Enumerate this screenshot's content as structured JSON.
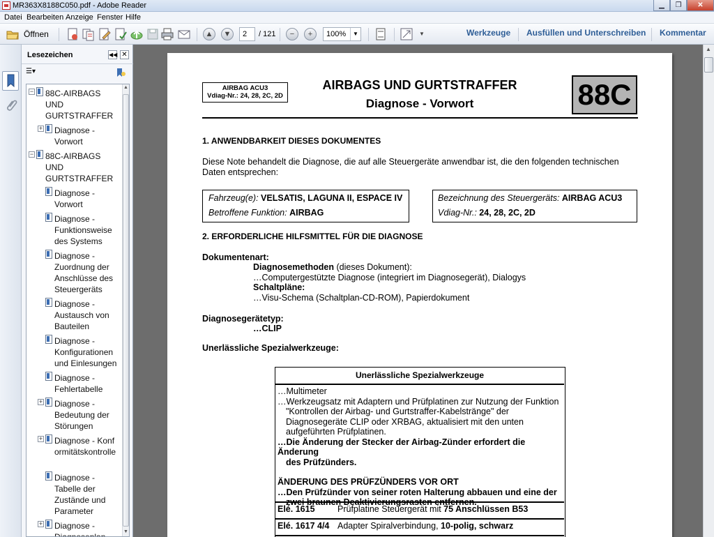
{
  "window": {
    "title": "MR363X8188C050.pdf - Adobe Reader"
  },
  "menu": [
    "Datei",
    "Bearbeiten",
    "Anzeige",
    "Fenster",
    "Hilfe"
  ],
  "toolbar": {
    "open_label": "Öffnen",
    "page_current": "2",
    "page_total": "/ 121",
    "zoom": "100%",
    "tools_label": "Werkzeuge",
    "fill_sign_label": "Ausfüllen und Unterschreiben",
    "comment_label": "Kommentar"
  },
  "bookmarks": {
    "title": "Lesezeichen",
    "items": [
      {
        "label": "88C-AIRBAGS UND GURTSTRAFFER"
      },
      {
        "label": "Diagnose - Vorwort"
      },
      {
        "label": "88C-AIRBAGS UND GURTSTRAFFER"
      },
      {
        "label": "Diagnose - Vorwort"
      },
      {
        "label": "Diagnose - Funktionsweise des Systems"
      },
      {
        "label": "Diagnose - Zuordnung der Anschlüsse des Steuergeräts"
      },
      {
        "label": "Diagnose - Austausch von Bauteilen"
      },
      {
        "label": "Diagnose - Konfigurationen und Einlesungen"
      },
      {
        "label": "Diagnose - Fehlertabelle"
      },
      {
        "label": "Diagnose - Bedeutung der Störungen"
      },
      {
        "label": "Diagnose - Konformitätskontrolle"
      },
      {
        "label": "Diagnose - Tabelle der Zustände und Parameter"
      },
      {
        "label": "Diagnose - Diagnoseplan"
      }
    ]
  },
  "doc": {
    "header_box_line1": "AIRBAG ACU3",
    "header_box_line2": "Vdiag-Nr.: 24, 28, 2C, 2D",
    "title": "AIRBAGS UND GURTSTRAFFER",
    "subtitle": "Diagnose - Vorwort",
    "code": "88C",
    "section1": "1. ANWENDBARKEIT DIESES DOKUMENTES",
    "intro": "Diese Note behandelt die Diagnose, die auf alle Steuergeräte anwendbar ist, die den folgenden technischen Daten entsprechen:",
    "vehicle_label": "Fahrzeug(e):",
    "vehicle_value": "VELSATIS, LAGUNA II, ESPACE IV",
    "function_label": "Betroffene Funktion:",
    "function_value": "AIRBAG",
    "ecu_label": "Bezeichnung des Steuergeräts:",
    "ecu_value": "AIRBAG ACU3",
    "vdiag_label": "Vdiag-Nr.:",
    "vdiag_value": "24, 28, 2C, 2D",
    "section2": "2. ERFORDERLICHE HILFSMITTEL FÜR DIE DIAGNOSE",
    "doc_type": "Dokumentenart:",
    "diag_methods": "Diagnosemethoden",
    "diag_methods_suffix": " (dieses Dokument):",
    "diag_methods_item": "…Computergestützte Diagnose (integriert im Diagnosegerät), Dialogys",
    "wiring": "Schaltpläne:",
    "wiring_item": "…Visu-Schema (Schaltplan-CD-ROM), Papierdokument",
    "diag_tool_type": "Diagnosegerätetyp:",
    "diag_tool_item": "…CLIP",
    "special_tools": "Unerlässliche Spezialwerkzeuge:",
    "table_header": "Unerlässliche Spezialwerkzeuge",
    "t_line1": "…Multimeter",
    "t_line2": "…Werkzeugsatz mit Adaptern und Prüfplatinen zur Nutzung der Funktion",
    "t_line3": "\"Kontrollen der Airbag- und Gurtstraffer-Kabelstränge\" der",
    "t_line4": "Diagnosegeräte CLIP oder XRBAG, aktualisiert mit den unten",
    "t_line5": "aufgeführten Prüfplatinen.",
    "t_line6": "…Die Änderung der Stecker der Airbag-Zünder erfordert die Änderung",
    "t_line7": "des Prüfzünders.",
    "t_heading2": "ÄNDERUNG DES PRÜFZÜNDERS VOR ORT",
    "t_line8": "…Den Prüfzünder von seiner roten Halterung abbauen und eine der",
    "t_line9": "zwei braunen Deaktivierungsrasten entfernen.",
    "row1_code": "Elé. 1615",
    "row1_desc_pre": "Prüfplatine Steuergerät mit ",
    "row1_desc_bold": "75 Anschlüssen B53",
    "row2_code": "Elé. 1617 4/4",
    "row2_desc_pre": "Adapter Spiralverbindung, ",
    "row2_desc_bold": "10-polig, schwarz"
  }
}
